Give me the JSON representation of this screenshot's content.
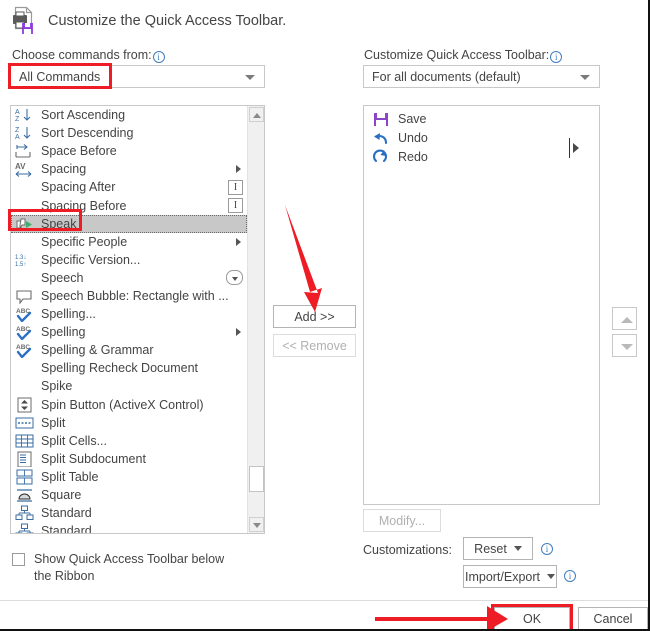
{
  "dialog": {
    "title": "Customize the Quick Access Toolbar.",
    "title_icon": "printer-save-icon"
  },
  "left_panel": {
    "label": "Choose commands from:",
    "label_info_icon": "info-icon",
    "combo_value": "All Commands",
    "combo_arrow_icon": "chevron-down-icon",
    "commands": [
      {
        "label": "Sort Ascending",
        "icon": "sort-ascending-icon",
        "submenu": false,
        "trailing": "none"
      },
      {
        "label": "Sort Descending",
        "icon": "sort-descending-icon",
        "submenu": false,
        "trailing": "none"
      },
      {
        "label": "Space Before",
        "icon": "space-before-icon",
        "submenu": false,
        "trailing": "none"
      },
      {
        "label": "Spacing",
        "icon": "spacing-av-icon",
        "submenu": true,
        "trailing": "none"
      },
      {
        "label": "Spacing After",
        "icon": "none",
        "submenu": false,
        "trailing": "textbox"
      },
      {
        "label": "Spacing Before",
        "icon": "none",
        "submenu": false,
        "trailing": "textbox"
      },
      {
        "label": "Speak",
        "icon": "speak-icon",
        "submenu": false,
        "trailing": "none",
        "selected": true
      },
      {
        "label": "Specific People",
        "icon": "none",
        "submenu": true,
        "trailing": "none"
      },
      {
        "label": "Specific Version...",
        "icon": "line-spacing-icon",
        "submenu": false,
        "trailing": "none"
      },
      {
        "label": "Speech",
        "icon": "none",
        "submenu": false,
        "trailing": "dropdown"
      },
      {
        "label": "Speech Bubble: Rectangle with ...",
        "icon": "speech-bubble-icon",
        "submenu": false,
        "trailing": "none"
      },
      {
        "label": "Spelling...",
        "icon": "spelling-abc-icon",
        "submenu": false,
        "trailing": "none"
      },
      {
        "label": "Spelling",
        "icon": "spelling-abc-icon",
        "submenu": true,
        "trailing": "none"
      },
      {
        "label": "Spelling & Grammar",
        "icon": "spelling-abc-icon",
        "submenu": false,
        "trailing": "none"
      },
      {
        "label": "Spelling Recheck Document",
        "icon": "none",
        "submenu": false,
        "trailing": "none"
      },
      {
        "label": "Spike",
        "icon": "none",
        "submenu": false,
        "trailing": "none"
      },
      {
        "label": "Spin Button (ActiveX Control)",
        "icon": "spin-button-icon",
        "submenu": false,
        "trailing": "none"
      },
      {
        "label": "Split",
        "icon": "split-icon",
        "submenu": false,
        "trailing": "none"
      },
      {
        "label": "Split Cells...",
        "icon": "split-cells-icon",
        "submenu": false,
        "trailing": "none"
      },
      {
        "label": "Split Subdocument",
        "icon": "split-subdocument-icon",
        "submenu": false,
        "trailing": "none"
      },
      {
        "label": "Split Table",
        "icon": "split-table-icon",
        "submenu": false,
        "trailing": "none"
      },
      {
        "label": "Square",
        "icon": "square-wrap-icon",
        "submenu": false,
        "trailing": "none"
      },
      {
        "label": "Standard",
        "icon": "hierarchy-icon",
        "submenu": false,
        "trailing": "none"
      },
      {
        "label": "Standard",
        "icon": "hierarchy-icon",
        "submenu": false,
        "trailing": "none"
      }
    ],
    "scroll_up_icon": "scroll-up-arrow-icon",
    "scroll_down_icon": "scroll-down-arrow-icon"
  },
  "middle": {
    "add_button": "Add >>",
    "remove_button": "<< Remove"
  },
  "right_panel": {
    "label": "Customize Quick Access Toolbar:",
    "label_info_icon": "info-icon",
    "combo_value": "For all documents (default)",
    "combo_arrow_icon": "chevron-down-icon",
    "items": [
      {
        "label": "Save",
        "icon": "save-floppy-icon"
      },
      {
        "label": "Undo",
        "icon": "undo-arrow-icon"
      },
      {
        "label": "Redo",
        "icon": "redo-arrow-icon"
      }
    ],
    "move_up_icon": "move-up-arrow-icon",
    "move_down_icon": "move-down-arrow-icon",
    "modify_button": "Modify...",
    "customizations_label": "Customizations:",
    "reset_button": "Reset",
    "reset_info_icon": "info-icon",
    "import_export_button": "Import/Export",
    "import_export_info_icon": "info-icon"
  },
  "footer": {
    "checkbox_label": "Show Quick Access Toolbar below the Ribbon",
    "checkbox_checked": false,
    "ok_button": "OK",
    "cancel_button": "Cancel"
  },
  "annotations": {
    "highlight_color": "#ee1c25",
    "focus_color": "#2a72c8",
    "boxes": [
      "all-commands-combo",
      "speak-list-item",
      "ok-button"
    ],
    "arrows": [
      "arrow-to-add-button",
      "arrow-to-ok-button"
    ]
  }
}
